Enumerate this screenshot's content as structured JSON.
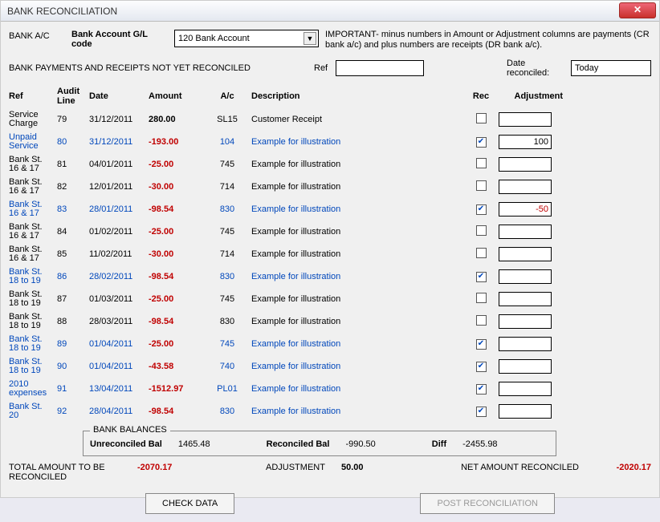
{
  "window": {
    "title": "BANK RECONCILIATION"
  },
  "header": {
    "bank_ac_label": "BANK A/C",
    "gl_code_label": "Bank Account G/L code",
    "account_selected": "120   Bank Account",
    "important_note": "IMPORTANT- minus numbers in Amount or Adjustment columns are payments (CR bank a/c)  and plus numbers are receipts (DR bank a/c).",
    "subtitle": "BANK PAYMENTS AND RECEIPTS NOT YET RECONCILED",
    "ref_label": "Ref",
    "ref_value": "",
    "date_rec_label": "Date reconciled:",
    "date_rec_value": "Today"
  },
  "columns": {
    "ref": "Ref",
    "audit": "Audit Line",
    "date": "Date",
    "amount": "Amount",
    "ac": "A/c",
    "desc": "Description",
    "rec": "Rec",
    "adj": "Adjustment"
  },
  "rows": [
    {
      "ref": "Service Charge",
      "audit": "79",
      "date": "31/12/2011",
      "amount": "280.00",
      "neg": false,
      "ac": "SL15",
      "desc": "Customer Receipt",
      "rec": false,
      "adj": "",
      "blue": false
    },
    {
      "ref": "Unpaid Service",
      "audit": "80",
      "date": "31/12/2011",
      "amount": "-193.00",
      "neg": true,
      "ac": "104",
      "desc": "Example for illustration",
      "rec": true,
      "adj": "100",
      "blue": true
    },
    {
      "ref": "Bank St. 16 & 17",
      "audit": "81",
      "date": "04/01/2011",
      "amount": "-25.00",
      "neg": true,
      "ac": "745",
      "desc": "Example for illustration",
      "rec": false,
      "adj": "",
      "blue": false
    },
    {
      "ref": "Bank St. 16 & 17",
      "audit": "82",
      "date": "12/01/2011",
      "amount": "-30.00",
      "neg": true,
      "ac": "714",
      "desc": "Example for illustration",
      "rec": false,
      "adj": "",
      "blue": false
    },
    {
      "ref": "Bank St. 16 & 17",
      "audit": "83",
      "date": "28/01/2011",
      "amount": "-98.54",
      "neg": true,
      "ac": "830",
      "desc": "Example for illustration",
      "rec": true,
      "adj": "-50",
      "blue": true
    },
    {
      "ref": "Bank St. 16 & 17",
      "audit": "84",
      "date": "01/02/2011",
      "amount": "-25.00",
      "neg": true,
      "ac": "745",
      "desc": "Example for illustration",
      "rec": false,
      "adj": "",
      "blue": false
    },
    {
      "ref": "Bank St. 16 & 17",
      "audit": "85",
      "date": "11/02/2011",
      "amount": "-30.00",
      "neg": true,
      "ac": "714",
      "desc": "Example for illustration",
      "rec": false,
      "adj": "",
      "blue": false
    },
    {
      "ref": "Bank St. 18 to 19",
      "audit": "86",
      "date": "28/02/2011",
      "amount": "-98.54",
      "neg": true,
      "ac": "830",
      "desc": "Example for illustration",
      "rec": true,
      "adj": "",
      "blue": true
    },
    {
      "ref": "Bank St. 18 to 19",
      "audit": "87",
      "date": "01/03/2011",
      "amount": "-25.00",
      "neg": true,
      "ac": "745",
      "desc": "Example for illustration",
      "rec": false,
      "adj": "",
      "blue": false
    },
    {
      "ref": "Bank St. 18 to 19",
      "audit": "88",
      "date": "28/03/2011",
      "amount": "-98.54",
      "neg": true,
      "ac": "830",
      "desc": "Example for illustration",
      "rec": false,
      "adj": "",
      "blue": false
    },
    {
      "ref": "Bank St. 18 to 19",
      "audit": "89",
      "date": "01/04/2011",
      "amount": "-25.00",
      "neg": true,
      "ac": "745",
      "desc": "Example for illustration",
      "rec": true,
      "adj": "",
      "blue": true
    },
    {
      "ref": "Bank St. 18 to 19",
      "audit": "90",
      "date": "01/04/2011",
      "amount": "-43.58",
      "neg": true,
      "ac": "740",
      "desc": "Example for illustration",
      "rec": true,
      "adj": "",
      "blue": true
    },
    {
      "ref": "2010 expenses",
      "audit": "91",
      "date": "13/04/2011",
      "amount": "-1512.97",
      "neg": true,
      "ac": "PL01",
      "desc": "Example for illustration",
      "rec": true,
      "adj": "",
      "blue": true
    },
    {
      "ref": "Bank St. 20",
      "audit": "92",
      "date": "28/04/2011",
      "amount": "-98.54",
      "neg": true,
      "ac": "830",
      "desc": "Example for illustration",
      "rec": true,
      "adj": "",
      "blue": true
    }
  ],
  "balances": {
    "legend": "BANK BALANCES",
    "unrec_label": "Unreconciled Bal",
    "unrec_val": "1465.48",
    "rec_label": "Reconciled Bal",
    "rec_val": "-990.50",
    "diff_label": "Diff",
    "diff_val": "-2455.98"
  },
  "totals": {
    "total_label": "TOTAL AMOUNT TO BE RECONCILED",
    "total_val": "-2070.17",
    "adj_label": "ADJUSTMENT",
    "adj_val": "50.00",
    "net_label": "NET AMOUNT RECONCILED",
    "net_val": "-2020.17"
  },
  "buttons": {
    "check": "CHECK DATA",
    "post": "POST RECONCILIATION"
  }
}
